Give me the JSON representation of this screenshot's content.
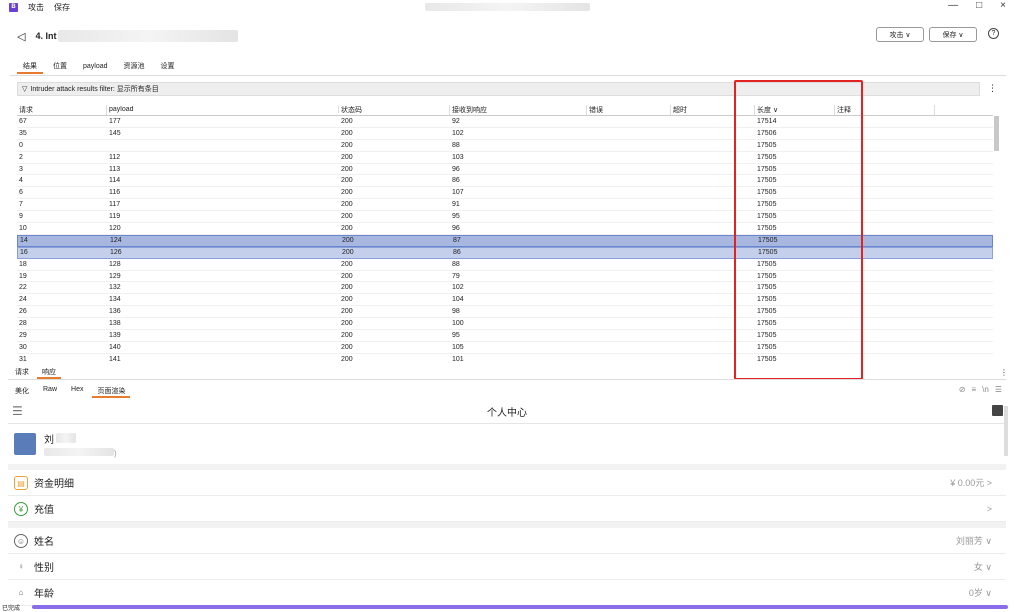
{
  "window": {
    "menu": [
      "攻击",
      "保存"
    ],
    "controls": [
      "—",
      "□",
      "×"
    ]
  },
  "header": {
    "title": "4. Int",
    "attack_btn": "攻击 ∨",
    "save_btn": "保存 ∨"
  },
  "tabs": [
    "结果",
    "位置",
    "payload",
    "资源池",
    "设置"
  ],
  "filter": "Intruder attack results filter: 显示所有条目",
  "table": {
    "columns": [
      "请求",
      "payload",
      "状态码",
      "接收到响应",
      "错误",
      "超时",
      "长度 ∨",
      "注释"
    ],
    "rows": [
      [
        "67",
        "177",
        "200",
        "92",
        "",
        "",
        "17514",
        ""
      ],
      [
        "35",
        "145",
        "200",
        "102",
        "",
        "",
        "17506",
        ""
      ],
      [
        "0",
        "",
        "200",
        "88",
        "",
        "",
        "17505",
        ""
      ],
      [
        "2",
        "112",
        "200",
        "103",
        "",
        "",
        "17505",
        ""
      ],
      [
        "3",
        "113",
        "200",
        "96",
        "",
        "",
        "17505",
        ""
      ],
      [
        "4",
        "114",
        "200",
        "86",
        "",
        "",
        "17505",
        ""
      ],
      [
        "6",
        "116",
        "200",
        "107",
        "",
        "",
        "17505",
        ""
      ],
      [
        "7",
        "117",
        "200",
        "91",
        "",
        "",
        "17505",
        ""
      ],
      [
        "9",
        "119",
        "200",
        "95",
        "",
        "",
        "17505",
        ""
      ],
      [
        "10",
        "120",
        "200",
        "96",
        "",
        "",
        "17505",
        ""
      ],
      [
        "14",
        "124",
        "200",
        "87",
        "",
        "",
        "17505",
        ""
      ],
      [
        "16",
        "126",
        "200",
        "86",
        "",
        "",
        "17505",
        ""
      ],
      [
        "18",
        "128",
        "200",
        "88",
        "",
        "",
        "17505",
        ""
      ],
      [
        "19",
        "129",
        "200",
        "79",
        "",
        "",
        "17505",
        ""
      ],
      [
        "22",
        "132",
        "200",
        "102",
        "",
        "",
        "17505",
        ""
      ],
      [
        "24",
        "134",
        "200",
        "104",
        "",
        "",
        "17505",
        ""
      ],
      [
        "26",
        "136",
        "200",
        "98",
        "",
        "",
        "17505",
        ""
      ],
      [
        "28",
        "138",
        "200",
        "100",
        "",
        "",
        "17505",
        ""
      ],
      [
        "29",
        "139",
        "200",
        "95",
        "",
        "",
        "17505",
        ""
      ],
      [
        "30",
        "140",
        "200",
        "105",
        "",
        "",
        "17505",
        ""
      ],
      [
        "31",
        "141",
        "200",
        "101",
        "",
        "",
        "17505",
        ""
      ]
    ]
  },
  "subtabs": [
    "请求",
    "响应"
  ],
  "viewtabs": [
    "美化",
    "Raw",
    "Hex",
    "页面渲染"
  ],
  "render": {
    "title": "个人中心",
    "name": "刘",
    "items": [
      {
        "label": "资金明细",
        "value": "¥ 0.00元 >"
      },
      {
        "label": "充值",
        "value": ">"
      }
    ],
    "info": [
      {
        "label": "姓名",
        "value": "刘丽芳 ∨"
      },
      {
        "label": "性别",
        "value": "女 ∨"
      },
      {
        "label": "年龄",
        "value": "0岁 ∨"
      }
    ]
  },
  "status": "已完成"
}
